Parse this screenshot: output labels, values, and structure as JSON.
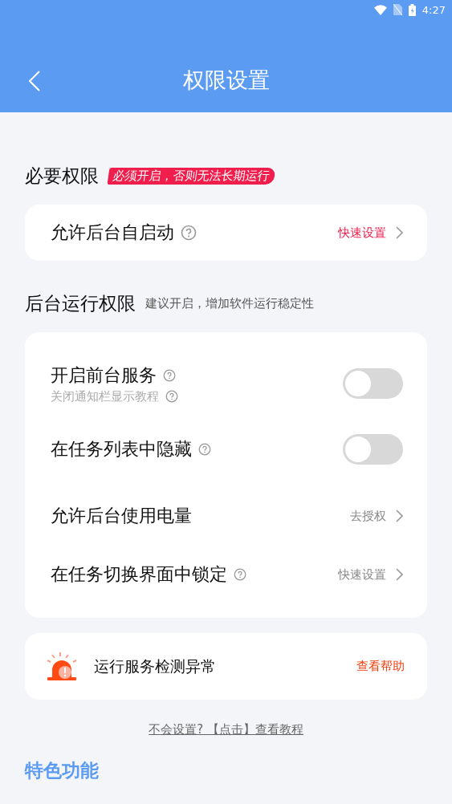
{
  "status_bar": {
    "time": "4:27"
  },
  "header": {
    "title": "权限设置"
  },
  "required": {
    "title": "必要权限",
    "badge": "必须开启，否则无法长期运行",
    "rows": [
      {
        "kind": "link",
        "label": "允许后台自启动",
        "help": true,
        "action": "快速设置",
        "accent": true
      }
    ]
  },
  "background": {
    "title": "后台运行权限",
    "hint": "建议开启，增加软件运行稳定性",
    "rows": [
      {
        "kind": "toggle",
        "label": "开启前台服务",
        "help": true,
        "subtitle": "关闭通知栏显示教程",
        "on": false
      },
      {
        "kind": "toggle",
        "label": "在任务列表中隐藏",
        "help": true,
        "on": false
      },
      {
        "kind": "link",
        "label": "允许后台使用电量",
        "help": false,
        "action": "去授权",
        "accent": false
      },
      {
        "kind": "link",
        "label": "在任务切换界面中锁定",
        "help": true,
        "action": "快速设置",
        "accent": false
      }
    ]
  },
  "alert": {
    "message": "运行服务检测异常",
    "action": "查看帮助"
  },
  "tutorial_link": "不会设置? 【点击】查看教程",
  "features": {
    "title": "特色功能"
  }
}
